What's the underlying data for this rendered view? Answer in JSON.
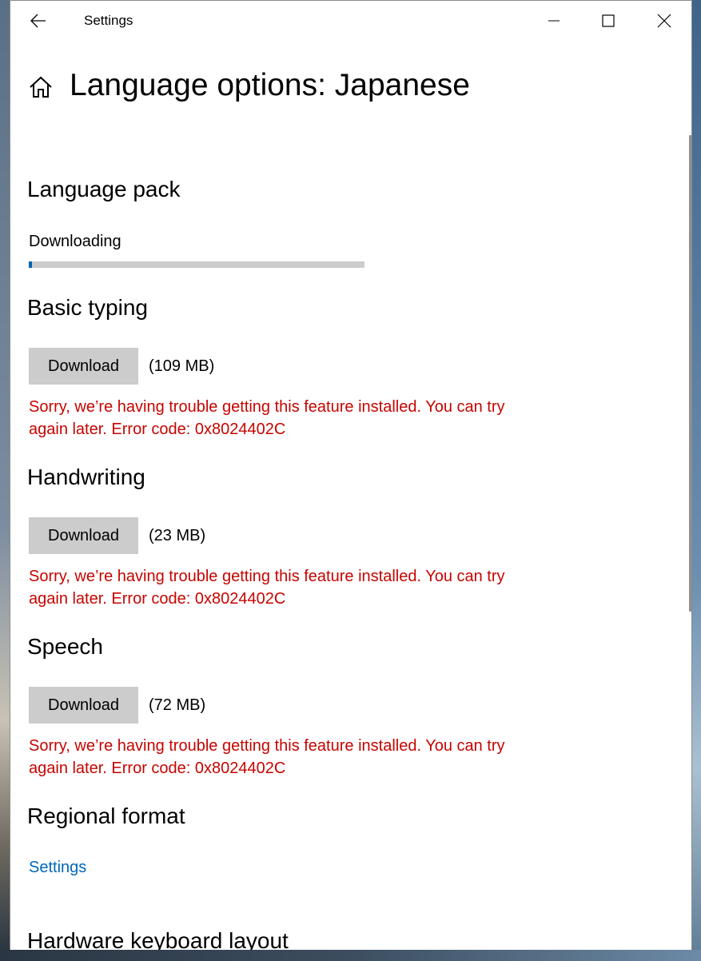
{
  "window": {
    "title": "Settings"
  },
  "page": {
    "title": "Language options: Japanese"
  },
  "language_pack": {
    "heading": "Language pack",
    "status": "Downloading",
    "progress": 0.01,
    "accent_color": "#0063b1"
  },
  "features": [
    {
      "heading": "Basic typing",
      "button_label": "Download",
      "size": "(109 MB)",
      "error": "Sorry, we’re having trouble getting this feature installed. You can try again later. Error code: 0x8024402C"
    },
    {
      "heading": "Handwriting",
      "button_label": "Download",
      "size": "(23 MB)",
      "error": "Sorry, we’re having trouble getting this feature installed. You can try again later. Error code: 0x8024402C"
    },
    {
      "heading": "Speech",
      "button_label": "Download",
      "size": "(72 MB)",
      "error": "Sorry, we’re having trouble getting this feature installed. You can try again later. Error code: 0x8024402C"
    }
  ],
  "regional_format": {
    "heading": "Regional format",
    "link_label": "Settings"
  },
  "hardware_keyboard": {
    "heading": "Hardware keyboard layout"
  },
  "icons": {
    "back": "back-arrow-icon",
    "home": "home-icon",
    "minimize": "minimize-icon",
    "maximize": "maximize-icon",
    "close": "close-icon"
  },
  "colors": {
    "error": "#c50500",
    "link": "#0067b8",
    "button_bg": "#cccccc"
  }
}
